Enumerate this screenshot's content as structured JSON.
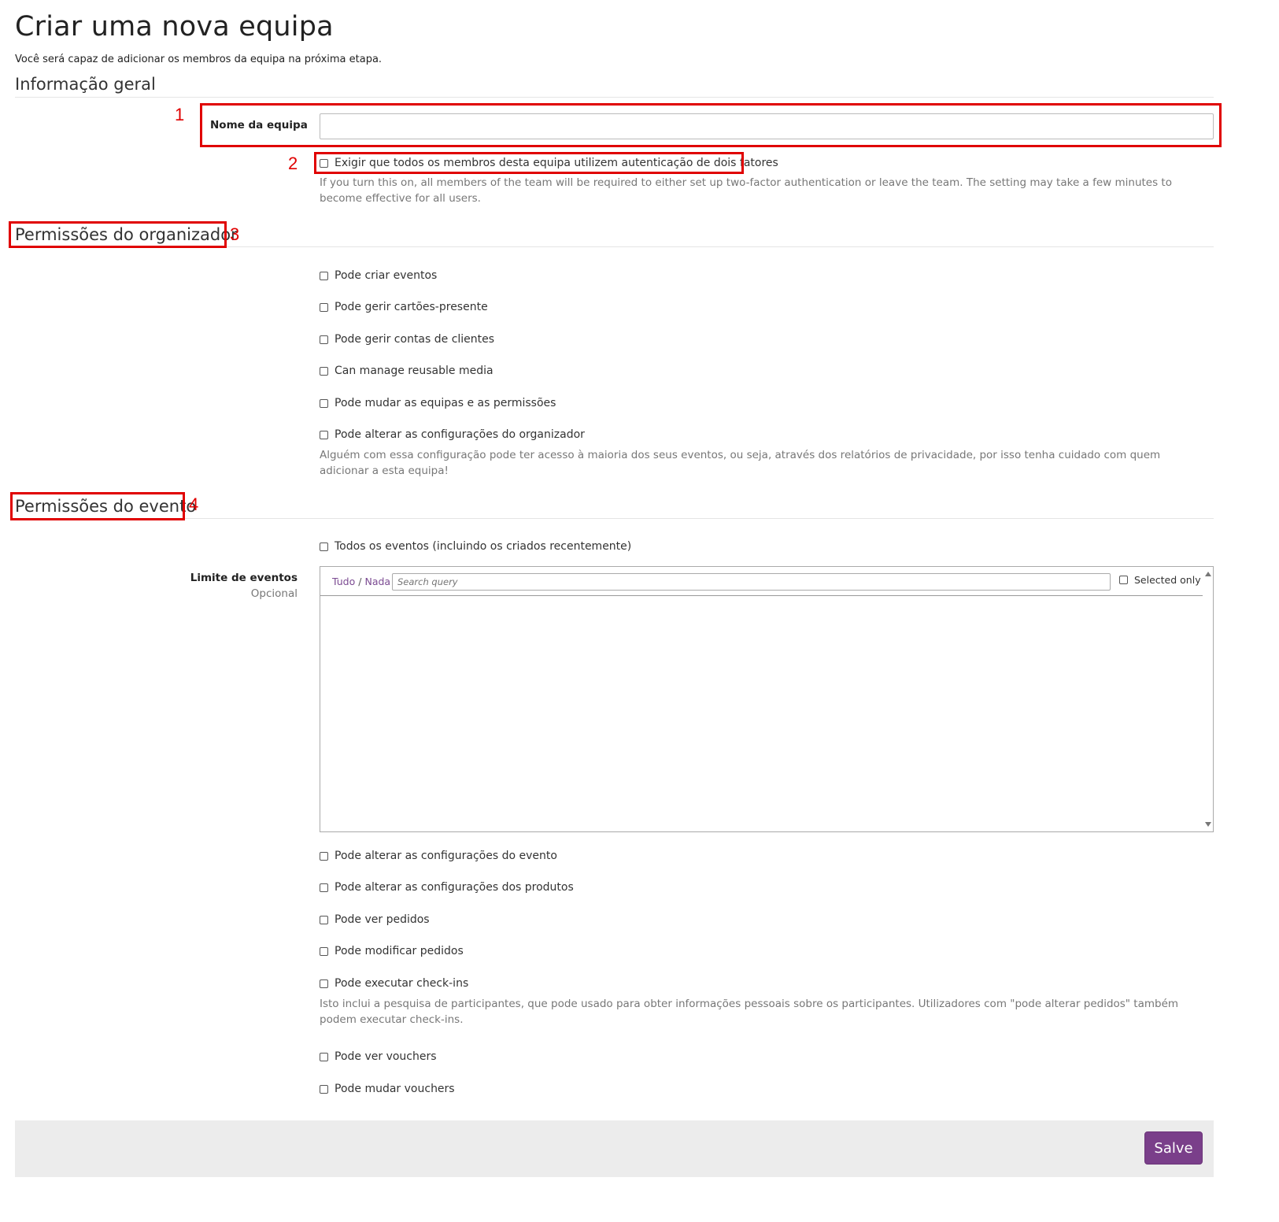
{
  "page": {
    "title": "Criar uma nova equipa",
    "subtitle": "Você será capaz de adicionar os membros da equipa na próxima etapa."
  },
  "general": {
    "heading": "Informação geral",
    "team_name_label": "Nome da equipa",
    "team_name_value": "",
    "require_2fa_label": "Exigir que todos os membros desta equipa utilizem autenticação de dois fatores",
    "require_2fa_help": "If you turn this on, all members of the team will be required to either set up two-factor authentication or leave the team. The setting may take a few minutes to become effective for all users."
  },
  "organizer": {
    "heading": "Permissões do organizador",
    "permissions": [
      "Pode criar eventos",
      "Pode gerir cartões-presente",
      "Pode gerir contas de clientes",
      "Can manage reusable media",
      "Pode mudar as equipas e as permissões",
      "Pode alterar as configurações do organizador"
    ],
    "settings_help": "Alguém com essa configuração pode ter acesso à maioria dos seus eventos, ou seja, através dos relatórios de privacidade, por isso tenha cuidado com quem adicionar a esta equipa!"
  },
  "event": {
    "heading": "Permissões do evento",
    "all_events_label": "Todos os eventos (incluindo os criados recentemente)",
    "limit_label": "Limite de eventos",
    "limit_optional": "Opcional",
    "picker": {
      "all": "Tudo",
      "separator": "/",
      "none": "Nada",
      "search_placeholder": "Search query",
      "selected_only": "Selected only"
    },
    "permissions_a": [
      "Pode alterar as configurações do evento",
      "Pode alterar as configurações dos produtos",
      "Pode ver pedidos",
      "Pode modificar pedidos",
      "Pode executar check-ins"
    ],
    "checkin_help": "Isto inclui a pesquisa de participantes, que pode usado para obter informações pessoais sobre os participantes. Utilizadores com \"pode alterar pedidos\" também podem executar check-ins.",
    "permissions_b": [
      "Pode ver vouchers",
      "Pode mudar vouchers"
    ]
  },
  "annotations": [
    "1",
    "2",
    "3",
    "4"
  ],
  "footer": {
    "save_label": "Salve"
  },
  "colors": {
    "accent": "#7a3f8a",
    "annotation": "#e00000",
    "help_text": "#777777"
  }
}
